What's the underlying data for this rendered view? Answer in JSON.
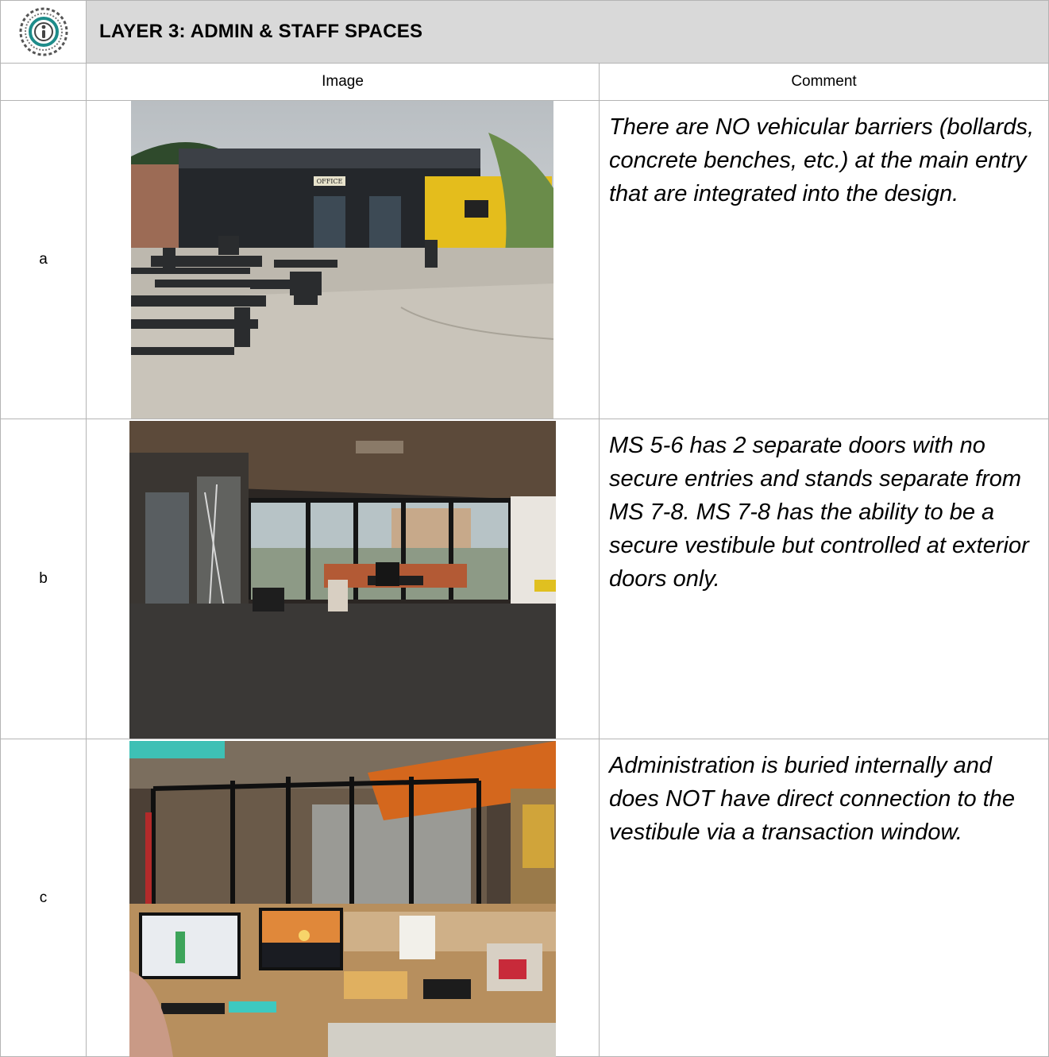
{
  "header": {
    "logo_icon": "eye-emblem-icon",
    "title": "LAYER 3: ADMIN & STAFF SPACES"
  },
  "columns": {
    "image": "Image",
    "comment": "Comment"
  },
  "rows": [
    {
      "label": "a",
      "photo_sign": "OFFICE",
      "comment": "There are NO vehicular barriers (bollards, concrete benches, etc.) at the main entry that are integrated into the design."
    },
    {
      "label": "b",
      "comment": "MS 5-6 has 2 separate doors with no secure entries and stands separate from MS 7-8. MS 7-8 has the ability to be a secure vestibule but controlled at exterior doors only."
    },
    {
      "label": "c",
      "comment": "Administration is buried internally and does NOT have direct connection to the vestibule via a transaction window."
    }
  ],
  "colors": {
    "header_bg": "#d9d9d9",
    "grid_line": "#b4b4b4",
    "logo_teal": "#1e8c8a"
  }
}
